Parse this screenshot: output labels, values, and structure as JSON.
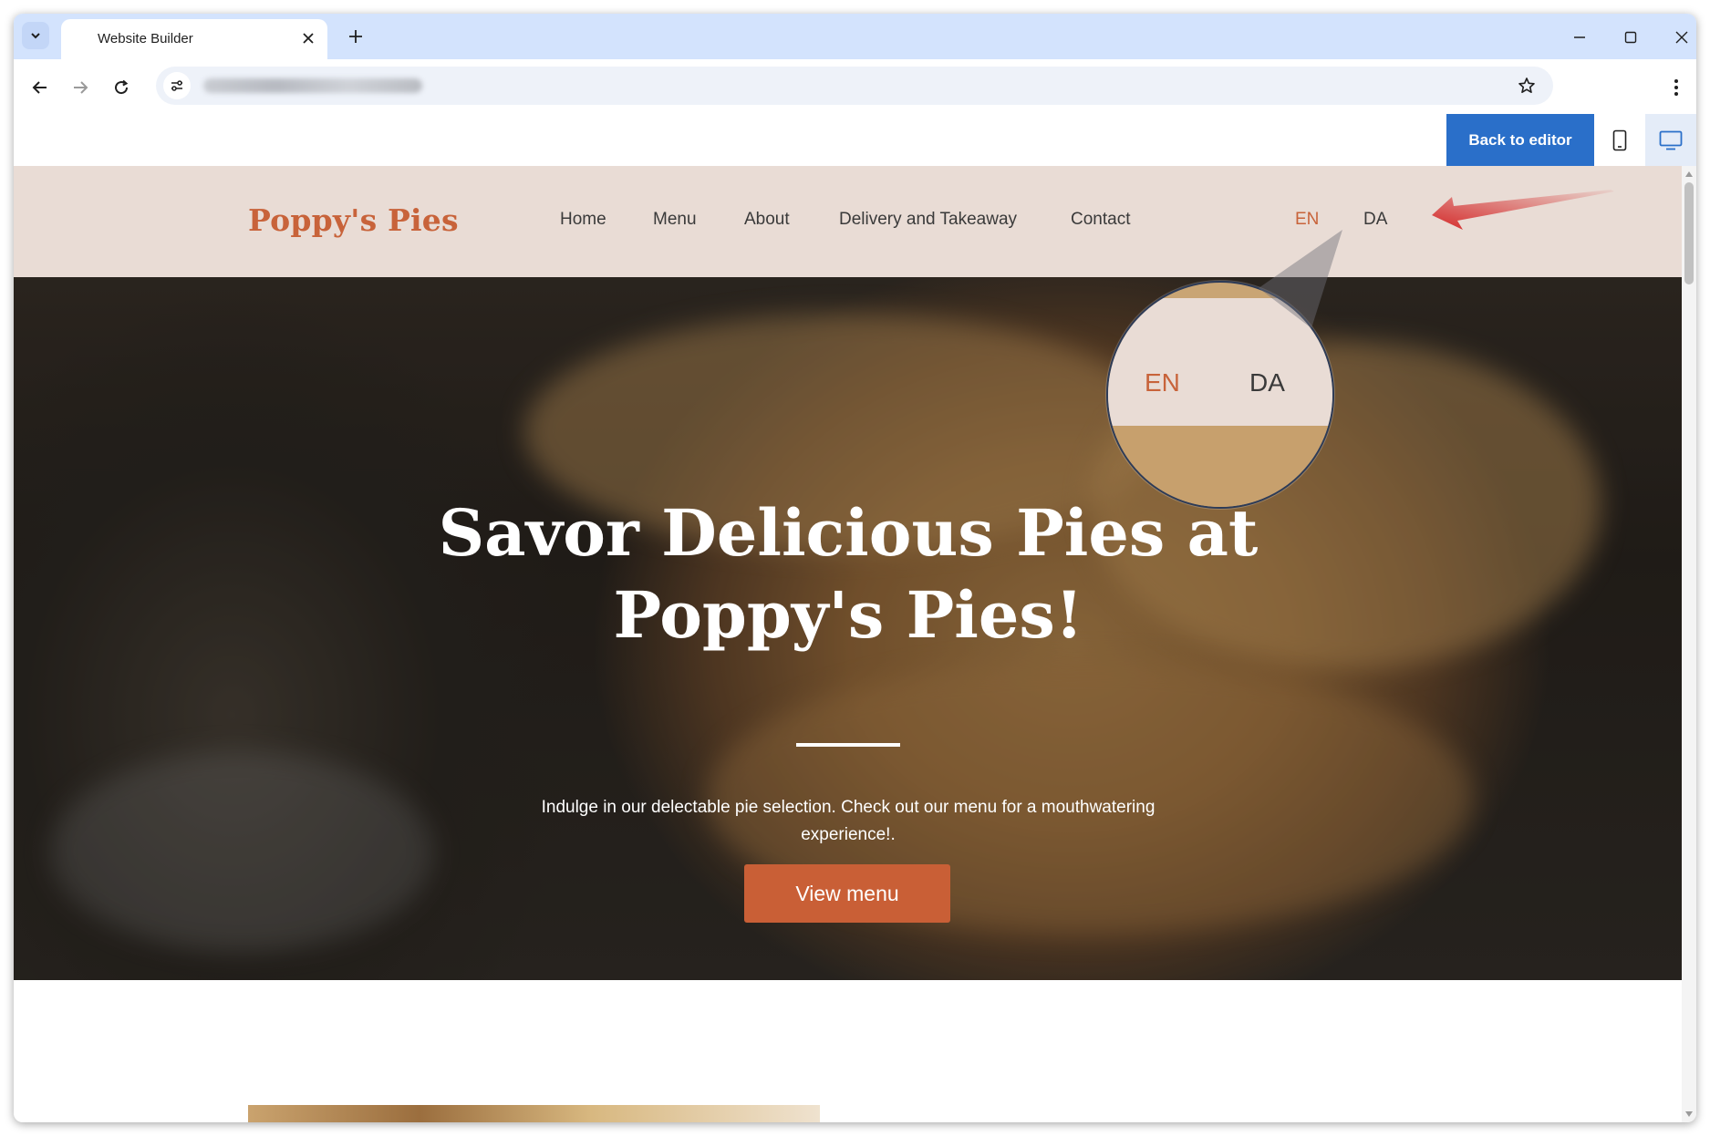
{
  "browser": {
    "tab_title": "Website Builder",
    "url_blurred": true
  },
  "editor": {
    "back_label": "Back to editor",
    "active_device": "desktop",
    "accent_color": "#2a6fc9"
  },
  "site": {
    "brand": "Poppy's Pies",
    "brand_color": "#c8633a",
    "nav": [
      "Home",
      "Menu",
      "About",
      "Delivery and Takeaway",
      "Contact"
    ],
    "languages": {
      "active": "EN",
      "other": "DA"
    },
    "hero": {
      "title": "Savor Delicious Pies at Poppy's Pies!",
      "subtitle": "Indulge in our delectable pie selection. Check out our menu for a mouthwatering experience!.",
      "cta": "View menu"
    }
  },
  "annotation": {
    "zoom": {
      "en": "EN",
      "da": "DA"
    },
    "arrow_color": "#d42a2a"
  },
  "icons": [
    "chevron-down-icon",
    "close-icon",
    "plus-icon",
    "minimize-icon",
    "maximize-icon",
    "back-arrow-icon",
    "forward-arrow-icon",
    "reload-icon",
    "site-settings-icon",
    "star-icon",
    "kebab-menu-icon",
    "mobile-icon",
    "desktop-icon"
  ]
}
